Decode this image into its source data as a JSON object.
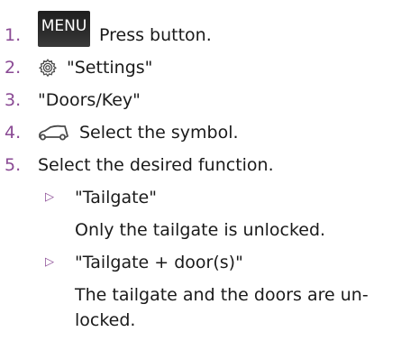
{
  "steps": [
    {
      "number": "1.",
      "button_label": "MENU",
      "text": "Press button."
    },
    {
      "number": "2.",
      "icon": "gear-icon",
      "text": "\"Settings\""
    },
    {
      "number": "3.",
      "text": "\"Doors/Key\""
    },
    {
      "number": "4.",
      "icon": "car-icon",
      "text": "Select the symbol."
    },
    {
      "number": "5.",
      "text": "Select the desired function."
    }
  ],
  "options": [
    {
      "bullet": "▷",
      "label": "\"Tailgate\"",
      "description_lines": [
        "Only the tailgate is unlocked."
      ]
    },
    {
      "bullet": "▷",
      "label": "\"Tailgate + door(s)\"",
      "description_lines": [
        "The tailgate and the doors are un-",
        "locked."
      ]
    }
  ],
  "colors": {
    "step_number": "#8a4a94",
    "text": "#1a1a1a",
    "button_bg": "#2a2a2a",
    "button_text": "#ffffff"
  }
}
